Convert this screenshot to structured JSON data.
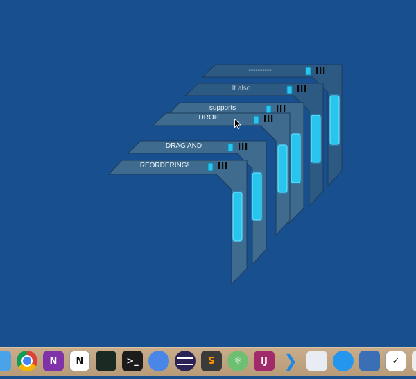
{
  "windows": [
    {
      "label": "----------",
      "muted": true
    },
    {
      "label": "It also",
      "muted": true
    },
    {
      "label": "supports",
      "muted": false
    },
    {
      "label": "DROP",
      "muted": false
    },
    {
      "label": "DRAG AND",
      "muted": false
    },
    {
      "label": "REORDERING!",
      "muted": false
    }
  ],
  "colors": {
    "desktop": "#174f8f",
    "panel": "#3f6c8e",
    "panel_dark": "#2c5a83",
    "accent": "#28c6ee",
    "handle": "#0b0b0b"
  },
  "dock": {
    "icons": [
      {
        "name": "finder-icon",
        "bg": "#4aa3e8",
        "glyph": ""
      },
      {
        "name": "chrome-icon",
        "bg": "#ffffff",
        "glyph": ""
      },
      {
        "name": "onenote-icon",
        "bg": "#8033a8",
        "glyph": "N"
      },
      {
        "name": "notion-icon",
        "bg": "#ffffff",
        "glyph": "N"
      },
      {
        "name": "activity-monitor-icon",
        "bg": "#1b2a22",
        "glyph": ""
      },
      {
        "name": "terminal-icon",
        "bg": "#1c1c1c",
        "glyph": ">_"
      },
      {
        "name": "messages-icon",
        "bg": "#4a86e8",
        "glyph": ""
      },
      {
        "name": "eclipse-icon",
        "bg": "#2c2255",
        "glyph": ""
      },
      {
        "name": "sublime-text-icon",
        "bg": "#3a3a3a",
        "glyph": "S"
      },
      {
        "name": "atom-icon",
        "bg": "#6fbf73",
        "glyph": "⚛"
      },
      {
        "name": "intellij-icon",
        "bg": "#a02a6a",
        "glyph": "IJ"
      },
      {
        "name": "vscode-icon",
        "bg": "#1e7fd0",
        "glyph": ""
      },
      {
        "name": "xcode-instruments-icon",
        "bg": "#e8edf4",
        "glyph": ""
      },
      {
        "name": "docker-icon",
        "bg": "#2496ed",
        "glyph": ""
      },
      {
        "name": "virtualbox-icon",
        "bg": "#3a6fb5",
        "glyph": ""
      },
      {
        "name": "tasks-icon",
        "bg": "#ffffff",
        "glyph": "✓"
      },
      {
        "name": "documents-icon",
        "bg": "#eeeeee",
        "glyph": ""
      }
    ]
  }
}
